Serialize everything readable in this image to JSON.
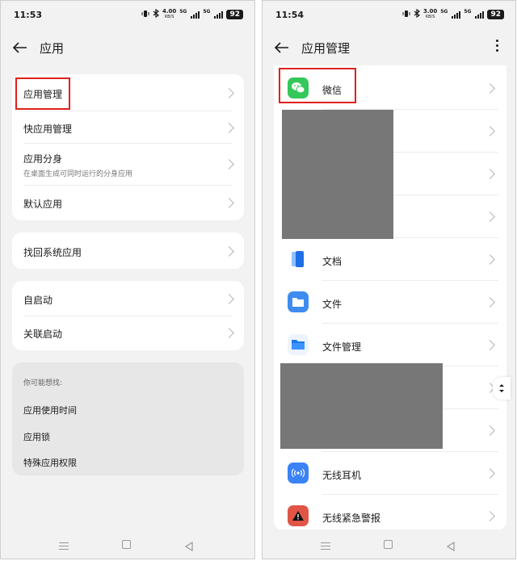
{
  "left": {
    "status": {
      "time": "11:53",
      "net_speed": "4.00",
      "net_unit": "KB/S",
      "signal_label_1": "5G",
      "signal_label_2": "5G",
      "battery": "92"
    },
    "header": {
      "title": "应用"
    },
    "card1": [
      {
        "label": "应用管理"
      },
      {
        "label": "快应用管理"
      },
      {
        "label": "应用分身",
        "sub": "在桌面生成可同时运行的分身应用"
      },
      {
        "label": "默认应用"
      }
    ],
    "card2": [
      {
        "label": "找回系统应用"
      }
    ],
    "card3": [
      {
        "label": "自启动"
      },
      {
        "label": "关联启动"
      }
    ],
    "suggest": {
      "header": "你可能想找:",
      "items": [
        "应用使用时间",
        "应用锁",
        "特殊应用权限"
      ]
    }
  },
  "right": {
    "status": {
      "time": "11:54",
      "net_speed": "3.00",
      "net_unit": "KB/S",
      "signal_label_1": "5G",
      "signal_label_2": "5G",
      "battery": "92"
    },
    "header": {
      "title": "应用管理"
    },
    "apps": [
      {
        "name": "微信",
        "icon": "wechat-icon",
        "color": "#34c759"
      },
      {
        "name": "",
        "icon": "",
        "color": ""
      },
      {
        "name": "",
        "icon": "",
        "color": ""
      },
      {
        "name": "",
        "icon": "",
        "color": ""
      },
      {
        "name": "文档",
        "icon": "docs-icon",
        "color": "#1e6fe6"
      },
      {
        "name": "文件",
        "icon": "files-icon",
        "color": "#3f8cf0"
      },
      {
        "name": "文件管理",
        "icon": "file-manager-icon",
        "color": "#1f7bea"
      },
      {
        "name": "",
        "icon": "",
        "color": ""
      },
      {
        "name": "",
        "icon": "",
        "color": ""
      },
      {
        "name": "无线耳机",
        "icon": "wireless-earphone-icon",
        "color": "#3b82f6"
      },
      {
        "name": "无线紧急警报",
        "icon": "emergency-alert-icon",
        "color": "#e05545"
      }
    ]
  },
  "colors": {
    "highlight": "#e0201c",
    "redacted": "#777777"
  }
}
